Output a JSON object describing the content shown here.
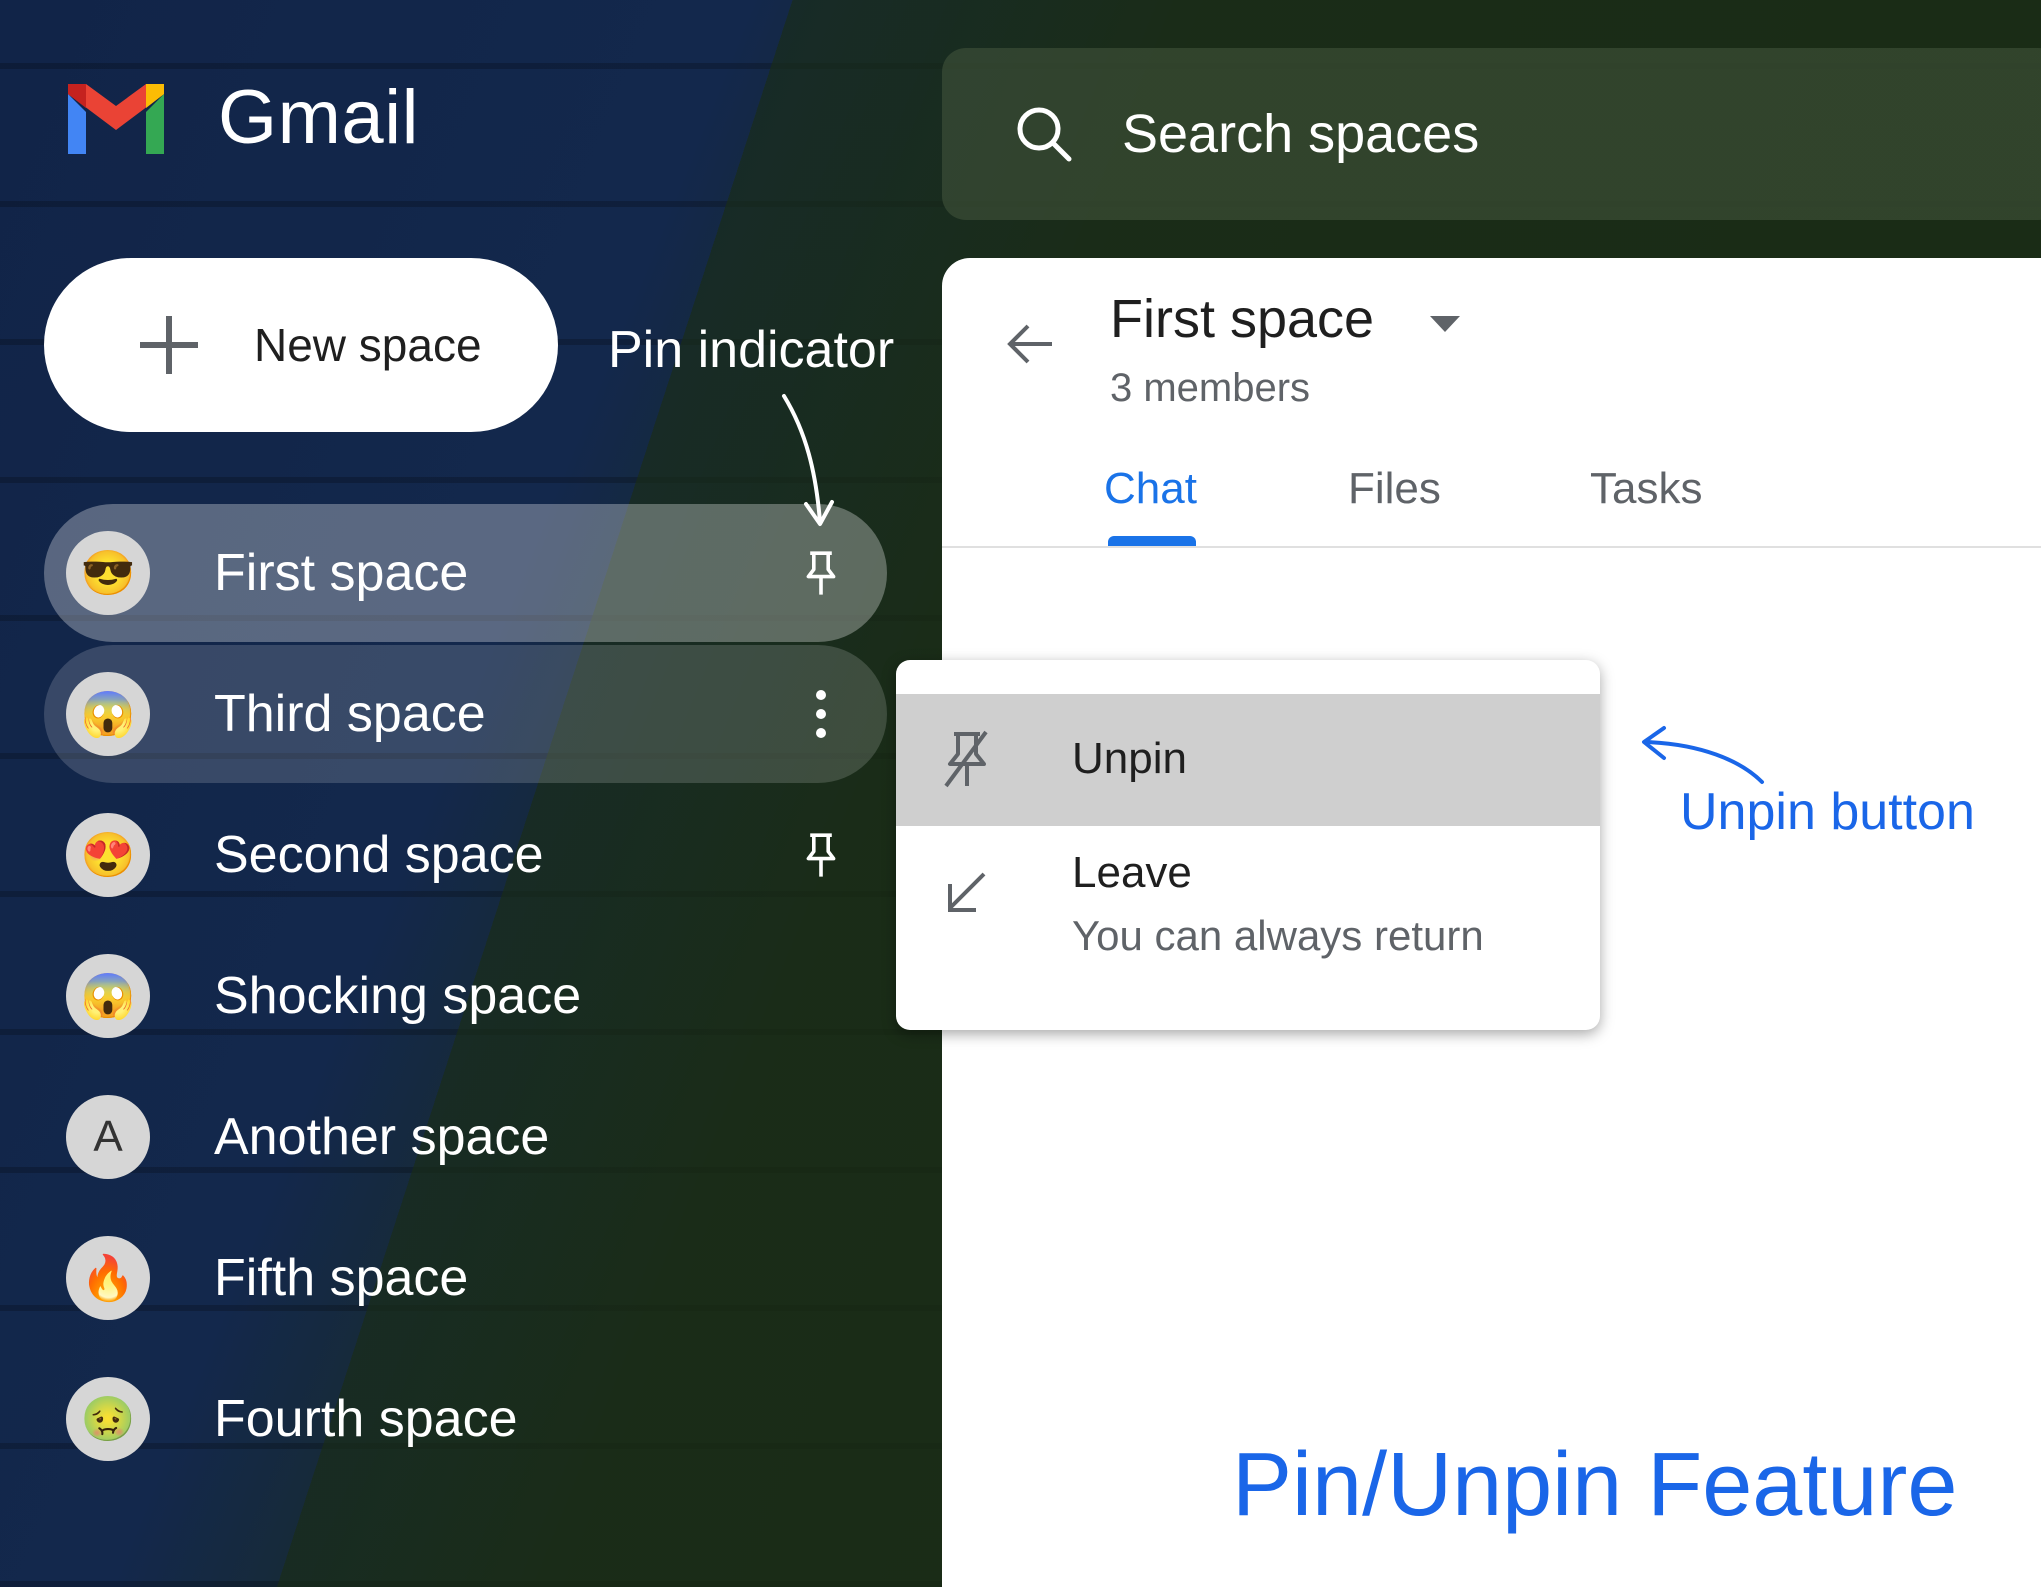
{
  "app": {
    "name": "Gmail"
  },
  "search": {
    "placeholder": "Search spaces"
  },
  "new_space": {
    "label": "New space"
  },
  "annotations": {
    "pin_indicator": "Pin indicator",
    "unpin_button": "Unpin button",
    "title": "Pin/Unpin Feature"
  },
  "spaces": [
    {
      "label": "First space",
      "avatar": "😎",
      "action": "pin-icon",
      "state": "active"
    },
    {
      "label": "Third space",
      "avatar": "😱",
      "action": "more-vert-icon",
      "state": "hover"
    },
    {
      "label": "Second space",
      "avatar": "😍",
      "action": "pin-icon",
      "state": "normal"
    },
    {
      "label": "Shocking space",
      "avatar": "😱",
      "action": "",
      "state": "normal"
    },
    {
      "label": "Another space",
      "avatar": "A",
      "action": "",
      "state": "normal"
    },
    {
      "label": "Fifth space",
      "avatar": "🔥",
      "action": "",
      "state": "normal"
    },
    {
      "label": "Fourth space",
      "avatar": "🤢",
      "action": "",
      "state": "normal"
    }
  ],
  "space_header": {
    "title": "First space",
    "members": "3 members",
    "tabs": [
      {
        "label": "Chat",
        "selected": true
      },
      {
        "label": "Files",
        "selected": false
      },
      {
        "label": "Tasks",
        "selected": false
      }
    ]
  },
  "menu": {
    "unpin": {
      "label": "Unpin",
      "icon": "unpin-icon"
    },
    "leave": {
      "label": "Leave",
      "sublabel": "You can always return",
      "icon": "leave-arrow-icon"
    }
  },
  "colors": {
    "accent": "#1a73e8",
    "annotation": "#1a66e8",
    "menu_highlight": "#cfcfcf"
  }
}
